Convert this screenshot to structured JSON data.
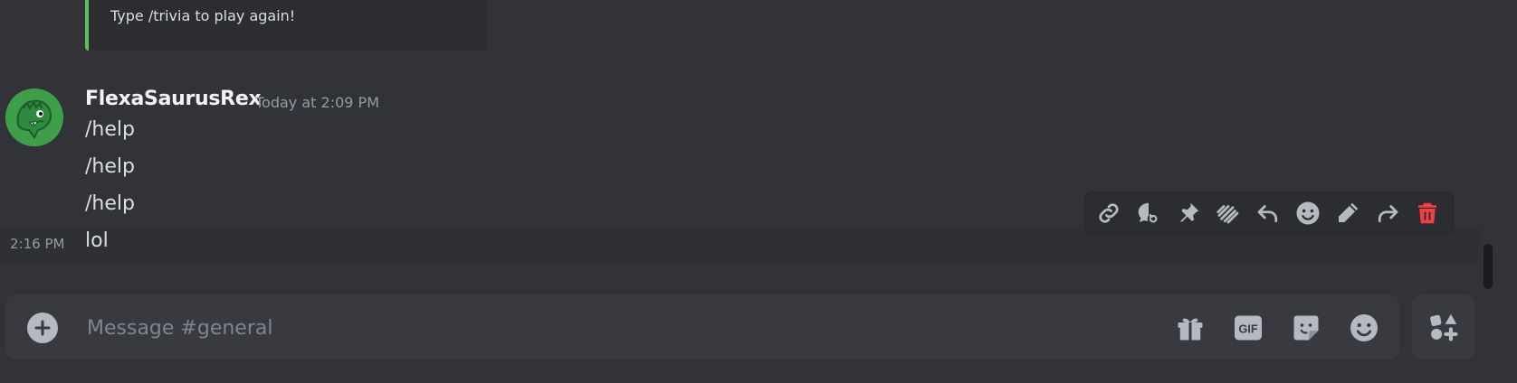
{
  "embed": {
    "text": "Type /trivia to play again!",
    "accent_color": "#57c25e"
  },
  "message_group": {
    "username": "FlexaSaurusRex",
    "timestamp": "Today at 2:09 PM",
    "avatar_icon": "dinosaur-avatar",
    "messages": [
      "/help",
      "/help",
      "/help"
    ]
  },
  "hovered_message": {
    "side_time": "2:16 PM",
    "text": "lol"
  },
  "toolbar": {
    "buttons": [
      {
        "name": "copy-link-icon"
      },
      {
        "name": "thread-icon"
      },
      {
        "name": "pin-icon"
      },
      {
        "name": "mark-unread-icon"
      },
      {
        "name": "reply-icon"
      },
      {
        "name": "add-reaction-icon"
      },
      {
        "name": "edit-icon"
      },
      {
        "name": "forward-icon"
      },
      {
        "name": "delete-icon",
        "color": "#f23f43"
      }
    ]
  },
  "composer": {
    "placeholder": "Message #general",
    "gif_label": "GIF",
    "icons": [
      "plus-icon",
      "gift-icon",
      "gif-icon",
      "sticker-icon",
      "emoji-icon",
      "apps-icon"
    ]
  }
}
